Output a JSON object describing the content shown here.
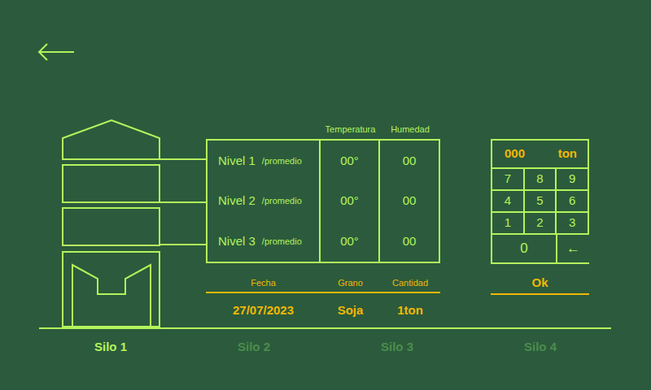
{
  "table": {
    "columns": [
      "Temperatura",
      "Humedad"
    ],
    "rows": [
      {
        "label": "Nivel 1",
        "sub": "/promedio",
        "temperature": "00°",
        "humidity": "00"
      },
      {
        "label": "Nivel 2",
        "sub": "/promedio",
        "temperature": "00°",
        "humidity": "00"
      },
      {
        "label": "Nivel 3",
        "sub": "/promedio",
        "temperature": "00°",
        "humidity": "00"
      }
    ]
  },
  "summary": [
    {
      "label": "Fecha",
      "value": "27/07/2023"
    },
    {
      "label": "Grano",
      "value": "Soja"
    },
    {
      "label": "Cantidad",
      "value": "1ton"
    }
  ],
  "keypad": {
    "display": {
      "value": "000",
      "unit": "ton"
    },
    "keys": [
      "7",
      "8",
      "9",
      "4",
      "5",
      "6",
      "1",
      "2",
      "3",
      "0",
      "←"
    ],
    "confirm": "Ok"
  },
  "tabs": [
    {
      "label": "Silo 1",
      "selected": true
    },
    {
      "label": "Silo 2",
      "selected": false
    },
    {
      "label": "Silo 3",
      "selected": false
    },
    {
      "label": "Silo 4",
      "selected": false
    }
  ]
}
